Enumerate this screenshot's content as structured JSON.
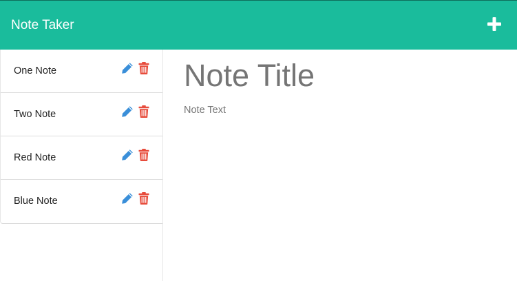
{
  "app": {
    "brand": "Note Taker",
    "accent_color": "#1abc9c"
  },
  "header": {
    "add_icon": "plus-icon"
  },
  "sidebar": {
    "notes": [
      {
        "label": "One Note",
        "edit_icon": "pencil-icon",
        "delete_icon": "trash-icon"
      },
      {
        "label": "Two Note",
        "edit_icon": "pencil-icon",
        "delete_icon": "trash-icon"
      },
      {
        "label": "Red Note",
        "edit_icon": "pencil-icon",
        "delete_icon": "trash-icon"
      },
      {
        "label": "Blue Note",
        "edit_icon": "pencil-icon",
        "delete_icon": "trash-icon"
      }
    ],
    "edit_color": "#3a8fd9",
    "delete_color": "#e74c3c"
  },
  "editor": {
    "title_placeholder": "Note Title",
    "title_value": "",
    "text_placeholder": "Note Text",
    "text_value": ""
  }
}
